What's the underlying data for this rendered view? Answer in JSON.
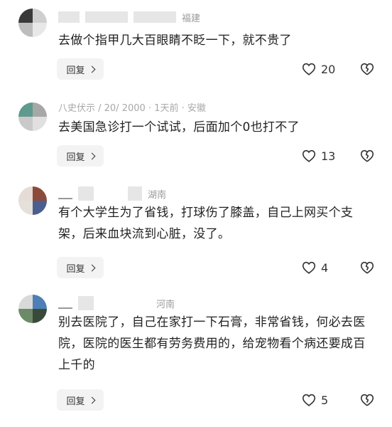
{
  "comments": [
    {
      "location": "福建",
      "content": "去做个指甲几大百眼睛不眨一下，就不贵了",
      "reply_label": "回复",
      "likes": "20",
      "avatar_colors": [
        "#3a3a3a",
        "#cfcfcf",
        "#bdbdbd",
        "#e8e8e8"
      ]
    },
    {
      "meta_text": "八史伏示 / 20/ 2000 · 1天前 · 安徽",
      "content": "去美国急诊打一个试试，后面加个0也打不了",
      "reply_label": "回复",
      "likes": "13",
      "avatar_colors": [
        "#5e9a8d",
        "#a7a7a7",
        "#c9c9c9",
        "#e0e0e0"
      ]
    },
    {
      "location": "湖南",
      "content": "有个大学生为了省钱，打球伤了膝盖，自己上网买个支架，后来血块流到心脏，没了。",
      "reply_label": "回复",
      "likes": "4",
      "avatar_colors": [
        "#e4dcd5",
        "#8c4a3b",
        "#e6e0da",
        "#4a5f8f"
      ]
    },
    {
      "location": "河南",
      "content": "别去医院了，自己在家打一下石膏，非常省钱，何必去医院，医院的医生都有劳务费用的，给宠物看个病还要成百上千的",
      "reply_label": "回复",
      "likes": "5",
      "avatar_colors": [
        "#d9d9d9",
        "#4f7fb7",
        "#6d8a68",
        "#3a4a3a"
      ]
    }
  ]
}
